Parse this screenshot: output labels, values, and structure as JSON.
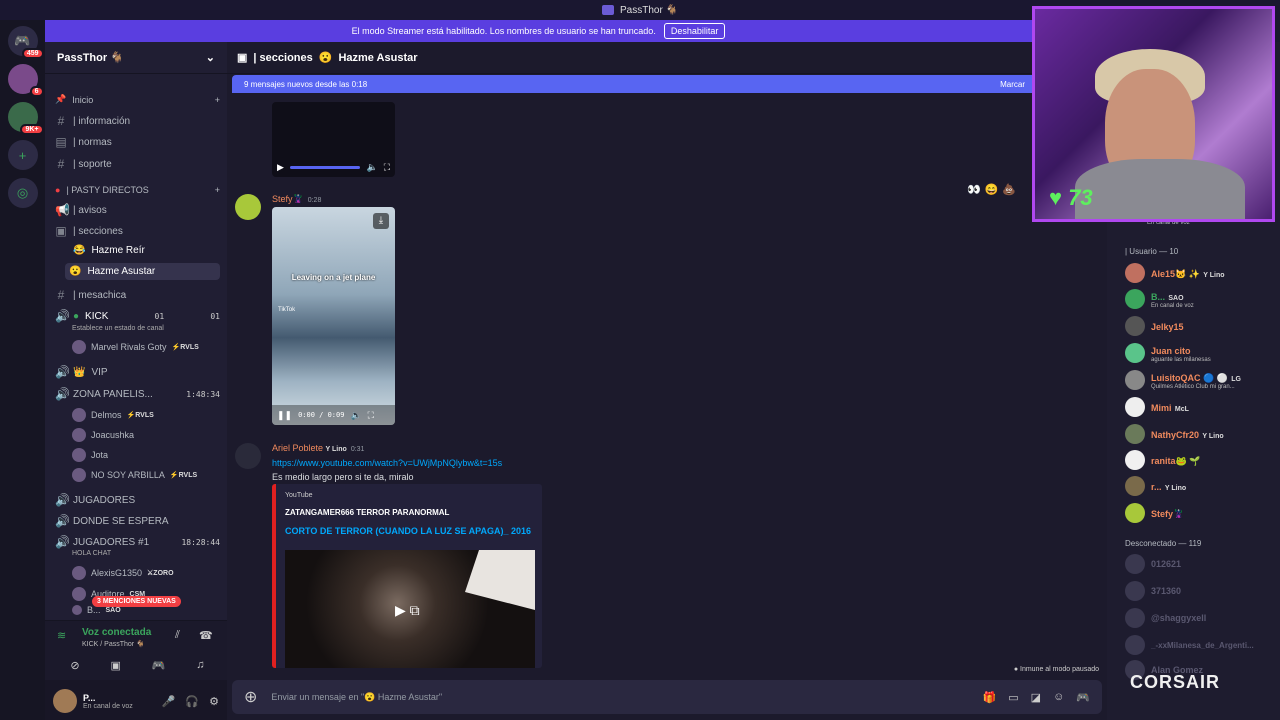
{
  "window": {
    "title": "PassThor 🐐"
  },
  "streamer_banner": {
    "text": "El modo Streamer está habilitado. Los nombres de usuario se han truncado.",
    "button": "Deshabilitar"
  },
  "servers": [
    {
      "icon": "discord-home-icon",
      "badge": "459"
    },
    {
      "icon": "server-icon",
      "badge": "6"
    },
    {
      "icon": "server-icon",
      "badge": "9K+"
    },
    {
      "icon": "add-server-icon",
      "badge": ""
    },
    {
      "icon": "explore-icon",
      "badge": ""
    }
  ],
  "guild": {
    "name": "PassThor 🐐"
  },
  "channels": {
    "inicio": "Inicio",
    "informacion": "| información",
    "normas": "| normas",
    "soporte": "| soporte",
    "pasty": "| PASTY DIRECTOS",
    "avisos": "| avisos",
    "secciones": "| secciones",
    "hazme_reir": "Hazme Reír",
    "hazme_asustar": "Hazme Asustar",
    "mesachica": "| mesachica",
    "kick": "KICK",
    "kick_count_a": "01",
    "kick_count_b": "01",
    "kick_status": "Establece un estado de canal",
    "kick_user": "Marvel Rivals Goty",
    "kick_user_tag": "⚡RVLS",
    "vip": "VIP",
    "zona": "ZONA PANELIS...",
    "zona_time": "1:48:34",
    "zona_users": [
      {
        "name": "Delmos",
        "tag": "⚡RVLS"
      },
      {
        "name": "Joacushka",
        "tag": ""
      },
      {
        "name": "Jota",
        "tag": ""
      },
      {
        "name": "NO SOY ARBILLA",
        "tag": "⚡RVLS"
      }
    ],
    "jugadores": "JUGADORES",
    "donde": "DONDE SE ESPERA",
    "jugadores1": "JUGADORES #1",
    "jugadores1_time": "18:28:44",
    "jugadores1_status": "HOLA CHAT",
    "alexis": "AlexisG1350",
    "alexis_tag": "⚔ZORO",
    "auditore": "Auditore",
    "auditore_tag": "CSM",
    "b_user": "B...",
    "b_tag": "SAO"
  },
  "mentions_pill": "3 MENCIONES NUEVAS",
  "voice_panel": {
    "title": "Voz conectada",
    "subtitle": "KICK / PassThor 🐐"
  },
  "user_panel": {
    "name": "P...",
    "status": "En canal de voz"
  },
  "chat_header": {
    "category": "| secciones",
    "channel": "Hazme Asustar"
  },
  "new_messages_bar": {
    "text": "9 mensajes nuevos desde las 0:18",
    "action": "Marcar"
  },
  "messages": [
    {
      "author": "Stefy🦹",
      "time": "0:28",
      "video_caption": "Leaving on a jet plane",
      "video_watermark": "TikTok",
      "video_time": "0:00 / 0:09"
    },
    {
      "author": "Ariel Poblete",
      "tag": "Y Lino",
      "time": "0:31",
      "link": "https://www.youtube.com/watch?v=UWjMpNQlybw&t=15s",
      "text": "Es medio largo pero si te da, miralo"
    }
  ],
  "embed": {
    "provider": "YouTube",
    "author": "ZATANGAMER666 TERROR PARANORMAL",
    "title": "CORTO DE TERROR (CUANDO LA LUZ SE APAGA)_ 2016"
  },
  "immune_text": "Inmune al modo pausado",
  "composer": {
    "placeholder": "Enviar un mensaje en \"😮 Hazme Asustar\""
  },
  "members": {
    "voice_header": "En canal de voz",
    "online_header": "| Usuario — 10",
    "online": [
      {
        "name": "Ale15🐱 ✨",
        "tag": "Y Lino",
        "status": "",
        "color": "#f08a5d"
      },
      {
        "name": "B...",
        "tag": "SAO",
        "status": "En canal de voz",
        "color": "#3ba55d"
      },
      {
        "name": "Jelky15",
        "tag": "",
        "status": "",
        "color": "#f08a5d"
      },
      {
        "name": "Juan cito",
        "tag": "",
        "status": "aguante las milanesas",
        "color": "#f08a5d"
      },
      {
        "name": "LuisitoQAC 🔵 ⚪",
        "tag": "LG",
        "status": "Quilmes Atlético Club mi gran...",
        "color": "#f08a5d"
      },
      {
        "name": "Mimi",
        "tag": "McL",
        "status": "",
        "color": "#f08a5d"
      },
      {
        "name": "NathyCfr20",
        "tag": "Y Lino",
        "status": "",
        "color": "#f08a5d"
      },
      {
        "name": "ranita🐸 🌱",
        "tag": "",
        "status": "",
        "color": "#f08a5d"
      },
      {
        "name": "r...",
        "tag": "Y Lino",
        "status": "",
        "color": "#f08a5d"
      },
      {
        "name": "Stefy🦹",
        "tag": "",
        "status": "",
        "color": "#f08a5d"
      }
    ],
    "offline_header": "Desconectado — 119",
    "offline": [
      "012621",
      "371360",
      "@shaggyxell",
      "_-xxMilanesa_de_Argenti...",
      "Alan Gomez"
    ]
  },
  "webcam": {
    "heart_count": "73"
  },
  "sponsor": "CORSAIR",
  "colors": {
    "accent": "#5865f2",
    "banner": "#5a3ee0",
    "webcam_border": "#b048f0",
    "link": "#00a8fc",
    "embed_border": "#e02020"
  }
}
